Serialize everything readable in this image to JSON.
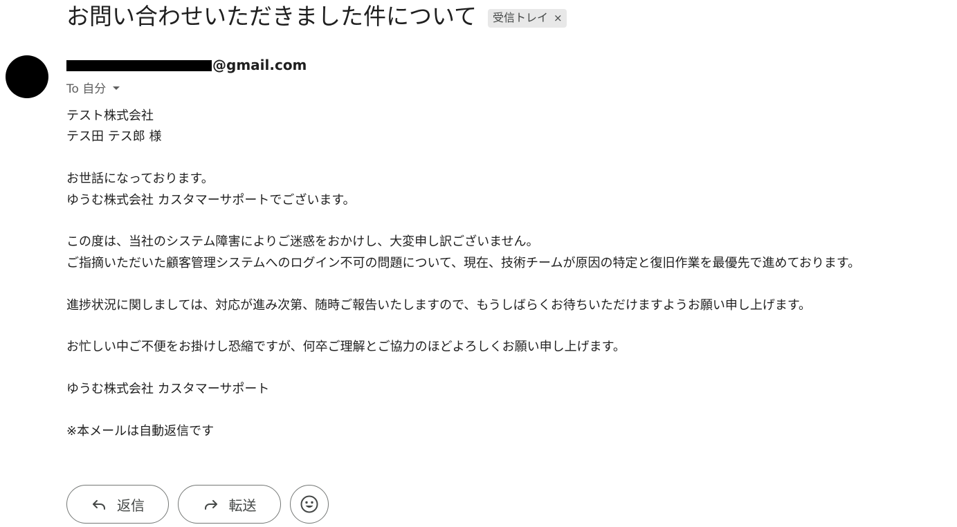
{
  "email": {
    "subject": "お問い合わせいただきました件について",
    "label": {
      "text": "受信トレイ",
      "close_glyph": "×"
    },
    "sender": {
      "avatar": "avatar",
      "redacted": true,
      "email_suffix": "@gmail.com"
    },
    "recipient": {
      "text": "To 自分",
      "icon": "chevron-down-icon"
    },
    "body": {
      "greeting": [
        "テスト株式会社",
        "テス田 テス郎 様"
      ],
      "intro": [
        "お世話になっております。",
        "ゆうむ株式会社 カスタマーサポートでございます。"
      ],
      "apology": [
        "この度は、当社のシステム障害によりご迷惑をおかけし、大変申し訳ございません。",
        "ご指摘いただいた顧客管理システムへのログイン不可の問題について、現在、技術チームが原因の特定と復旧作業を最優先で進めております。"
      ],
      "progress": "進捗状況に関しましては、対応が進み次第、随時ご報告いたしますので、もうしばらくお待ちいただけますようお願い申し上げます。",
      "closing": "お忙しい中ご不便をお掛けし恐縮ですが、何卒ご理解とご協力のほどよろしくお願い申し上げます。",
      "signature": "ゆうむ株式会社 カスタマーサポート",
      "note": "※本メールは自動返信です"
    }
  },
  "actions": {
    "reply": {
      "label": "返信",
      "icon": "reply-icon"
    },
    "forward": {
      "label": "転送",
      "icon": "forward-icon"
    },
    "emoji": {
      "icon": "emoji-icon"
    }
  },
  "colors": {
    "text": "#1f1f1f",
    "muted": "#5e5e5e",
    "chip_bg": "#e8e8e8",
    "button_border": "#747775"
  }
}
